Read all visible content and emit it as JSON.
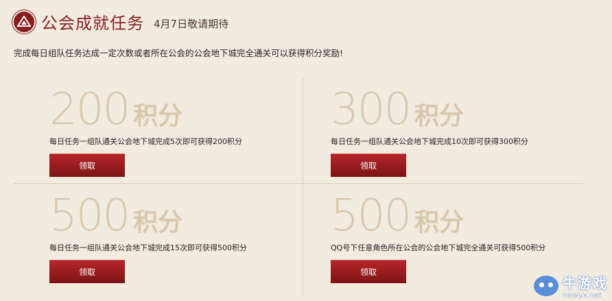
{
  "header": {
    "logo_icon": "guild-emblem-icon",
    "title": "公会成就任务",
    "subtitle": "4月7日敬请期待"
  },
  "description": "完成每日组队任务达成一定次数或者所在公会的公会地下城完全通关可以获得积分奖励!",
  "colors": {
    "accent": "#8a1f20",
    "background": "#f2ebe0",
    "points": "#d8c7ad",
    "button": "#a01e22"
  },
  "tasks": [
    {
      "points": "200",
      "unit": "积分",
      "text": "每日任务一组队通关公会地下城完成5次即可获得200积分",
      "button": "领取"
    },
    {
      "points": "300",
      "unit": "积分",
      "text": "每日任务一组队通关公会地下城完成10次即可获得300积分",
      "button": "领取"
    },
    {
      "points": "500",
      "unit": "积分",
      "text": "每日任务一组队通关公会地下城完成15次即可获得500积分",
      "button": "领取"
    },
    {
      "points": "500",
      "unit": "积分",
      "text": "QQ号下任意角色所在公会的公会地下城完全通关可获得500积分",
      "button": "领取"
    }
  ],
  "watermark": {
    "name": "牛游戏",
    "url": "newyx.net",
    "icon": "mascot-icon"
  }
}
